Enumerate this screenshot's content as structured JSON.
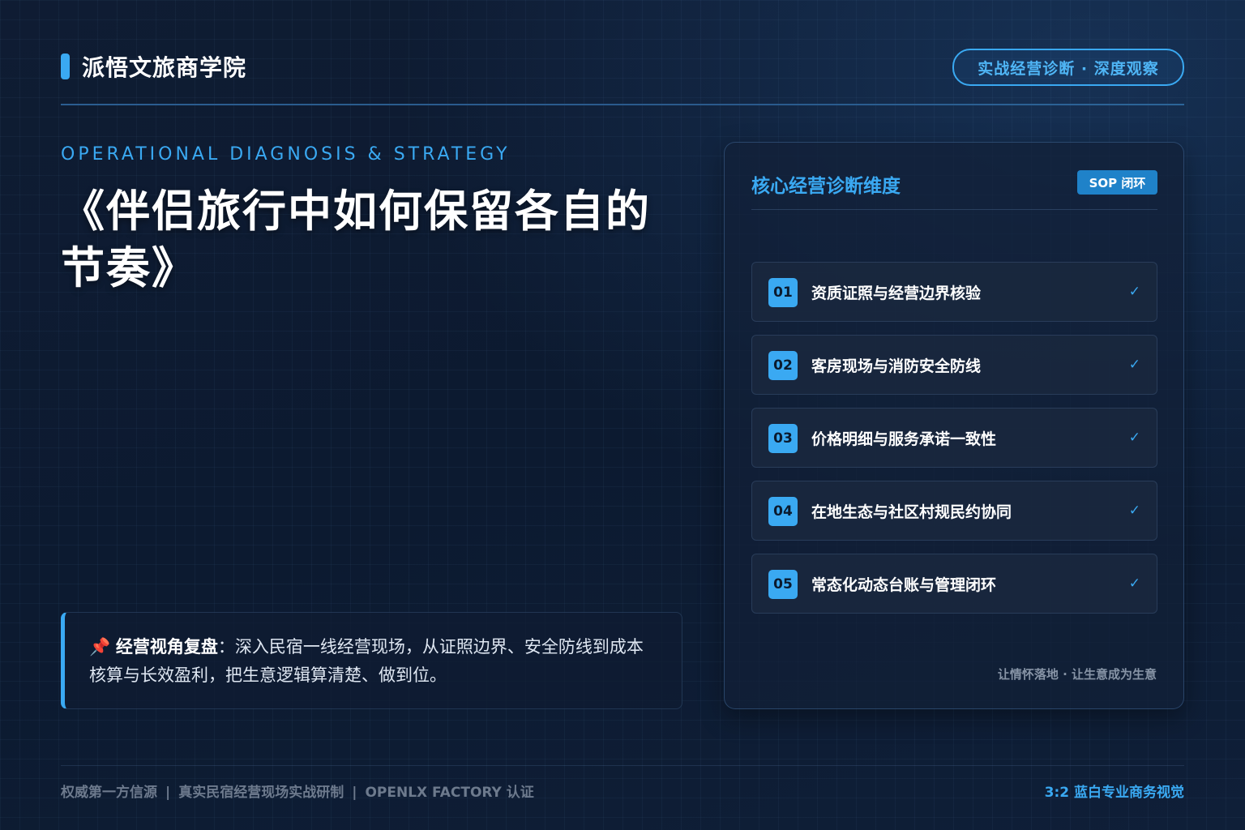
{
  "header": {
    "brand": "派悟文旅商学院",
    "badge": "实战经营诊断 · 深度观察"
  },
  "hero": {
    "eyebrow": "OPERATIONAL DIAGNOSIS & STRATEGY",
    "title": "《伴侣旅行中如何保留各自的节奏》"
  },
  "note": {
    "icon": "📌",
    "lead": "经营视角复盘",
    "text": "：深入民宿一线经营现场，从证照边界、安全防线到成本核算与长效盈利，把生意逻辑算清楚、做到位。"
  },
  "panel": {
    "title": "核心经营诊断维度",
    "tag": "SOP 闭环",
    "items": [
      {
        "num": "01",
        "label": "资质证照与经营边界核验",
        "check": "✓"
      },
      {
        "num": "02",
        "label": "客房现场与消防安全防线",
        "check": "✓"
      },
      {
        "num": "03",
        "label": "价格明细与服务承诺一致性",
        "check": "✓"
      },
      {
        "num": "04",
        "label": "在地生态与社区村规民约协同",
        "check": "✓"
      },
      {
        "num": "05",
        "label": "常态化动态台账与管理闭环",
        "check": "✓"
      }
    ],
    "footer": "让情怀落地 · 让生意成为生意"
  },
  "footer": {
    "left_items": [
      "权威第一方信源",
      "真实民宿经营现场实战研制",
      "OPENLX FACTORY 认证"
    ],
    "separator": "|",
    "right": "3:2 蓝白专业商务视觉"
  },
  "colors": {
    "accent": "#3aa9f2",
    "background": "#0f1c33",
    "muted": "#6d7a8d"
  }
}
